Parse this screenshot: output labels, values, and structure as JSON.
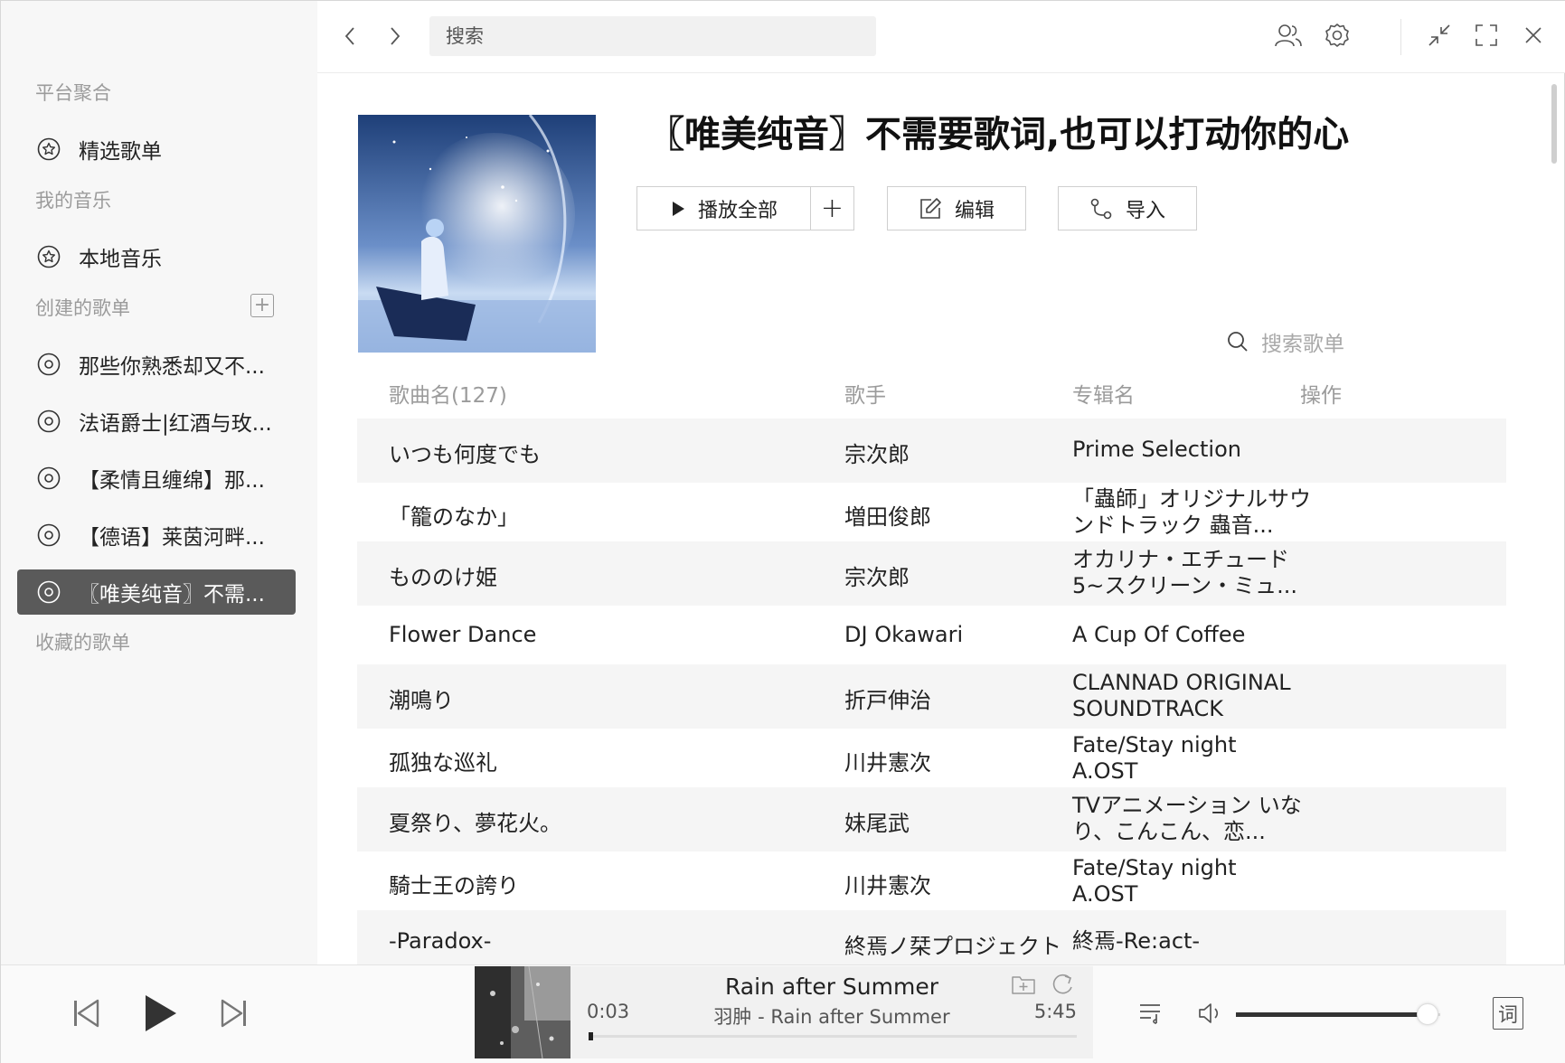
{
  "sidebar": {
    "section_platform": "平台聚合",
    "featured": "精选歌单",
    "section_my_music": "我的音乐",
    "local_music": "本地音乐",
    "section_created": "创建的歌单",
    "created_playlists": [
      "那些你熟悉却又不...",
      "法语爵士|红酒与玫...",
      "【柔情且缠绵】那...",
      "【德语】莱茵河畔...",
      "〖唯美纯音〗不需..."
    ],
    "section_collected": "收藏的歌单"
  },
  "topbar": {
    "search_placeholder": "搜索"
  },
  "playlist": {
    "title": "〖唯美纯音〗不需要歌词,也可以打动你的心",
    "play_all": "播放全部",
    "add": "+",
    "edit": "编辑",
    "import": "导入",
    "search_label": "搜索歌单"
  },
  "table": {
    "headers": {
      "title": "歌曲名(127)",
      "artist": "歌手",
      "album": "专辑名",
      "action": "操作"
    },
    "rows": [
      {
        "title": "いつも何度でも",
        "artist": "宗次郎",
        "album": "Prime Selection"
      },
      {
        "title": "「籠のなか」",
        "artist": "増田俊郎",
        "album": "「蟲師」オリジナルサウンドトラック 蟲音..."
      },
      {
        "title": "もののけ姫",
        "artist": "宗次郎",
        "album": "オカリナ・エチュード5~スクリーン・ミュ..."
      },
      {
        "title": "Flower Dance",
        "artist": "DJ Okawari",
        "album": "A Cup Of Coffee"
      },
      {
        "title": "潮鳴り",
        "artist": "折戸伸治",
        "album": "CLANNAD ORIGINAL SOUNDTRACK"
      },
      {
        "title": "孤独な巡礼",
        "artist": "川井憲次",
        "album": "Fate/Stay night A.OST"
      },
      {
        "title": "夏祭り、夢花火。",
        "artist": "妹尾武",
        "album": "TVアニメーション いなり、こんこん、恋..."
      },
      {
        "title": "騎士王の誇り",
        "artist": "川井憲次",
        "album": "Fate/Stay night A.OST"
      },
      {
        "title": "-Paradox-",
        "artist": "終焉ノ栞プロジェクト",
        "album": "終焉-Re:act-"
      }
    ]
  },
  "player": {
    "song_title": "Rain after Summer",
    "subtitle": "羽肿 - Rain after Summer",
    "current_time": "0:03",
    "total_time": "5:45",
    "progress_fraction": 0.009,
    "volume_fraction": 0.92,
    "lyrics_label": "词"
  }
}
